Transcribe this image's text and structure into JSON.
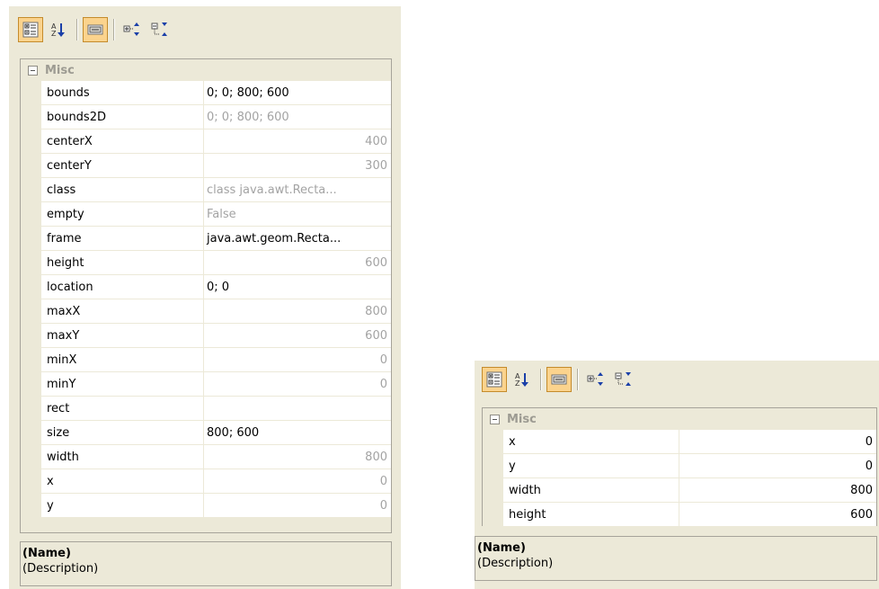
{
  "panels": [
    {
      "toolbar": {
        "categorized_icon": "categorized-icon",
        "alphabetical_icon": "alphabetical-sort-icon",
        "properties_icon": "property-pages-icon",
        "expand_icon": "expand-all-icon",
        "collapse_icon": "collapse-all-icon"
      },
      "category": "Misc",
      "properties": [
        {
          "name": "bounds",
          "value": "0; 0; 800; 600",
          "readonly": false,
          "align": "left"
        },
        {
          "name": "bounds2D",
          "value": "0; 0; 800; 600",
          "readonly": true,
          "align": "left"
        },
        {
          "name": "centerX",
          "value": "400",
          "readonly": true,
          "align": "right"
        },
        {
          "name": "centerY",
          "value": "300",
          "readonly": true,
          "align": "right"
        },
        {
          "name": "class",
          "value": "class java.awt.Recta...",
          "readonly": true,
          "align": "left"
        },
        {
          "name": "empty",
          "value": "False",
          "readonly": true,
          "align": "left"
        },
        {
          "name": "frame",
          "value": "java.awt.geom.Recta...",
          "readonly": false,
          "align": "left"
        },
        {
          "name": "height",
          "value": "600",
          "readonly": true,
          "align": "right"
        },
        {
          "name": "location",
          "value": "0; 0",
          "readonly": false,
          "align": "left"
        },
        {
          "name": "maxX",
          "value": "800",
          "readonly": true,
          "align": "right"
        },
        {
          "name": "maxY",
          "value": "600",
          "readonly": true,
          "align": "right"
        },
        {
          "name": "minX",
          "value": "0",
          "readonly": true,
          "align": "right"
        },
        {
          "name": "minY",
          "value": "0",
          "readonly": true,
          "align": "right"
        },
        {
          "name": "rect",
          "value": "",
          "readonly": false,
          "align": "left"
        },
        {
          "name": "size",
          "value": "800; 600",
          "readonly": false,
          "align": "left"
        },
        {
          "name": "width",
          "value": "800",
          "readonly": true,
          "align": "right"
        },
        {
          "name": "x",
          "value": "0",
          "readonly": true,
          "align": "right"
        },
        {
          "name": "y",
          "value": "0",
          "readonly": true,
          "align": "right"
        }
      ],
      "description": {
        "title": "(Name)",
        "text": "(Description)"
      }
    },
    {
      "toolbar": {
        "categorized_icon": "categorized-icon",
        "alphabetical_icon": "alphabetical-sort-icon",
        "properties_icon": "property-pages-icon",
        "expand_icon": "expand-all-icon",
        "collapse_icon": "collapse-all-icon"
      },
      "category": "Misc",
      "properties": [
        {
          "name": "x",
          "value": "0",
          "readonly": false,
          "align": "right"
        },
        {
          "name": "y",
          "value": "0",
          "readonly": false,
          "align": "right"
        },
        {
          "name": "width",
          "value": "800",
          "readonly": false,
          "align": "right"
        },
        {
          "name": "height",
          "value": "600",
          "readonly": false,
          "align": "right"
        }
      ],
      "description": {
        "title": "(Name)",
        "text": "(Description)"
      }
    }
  ]
}
